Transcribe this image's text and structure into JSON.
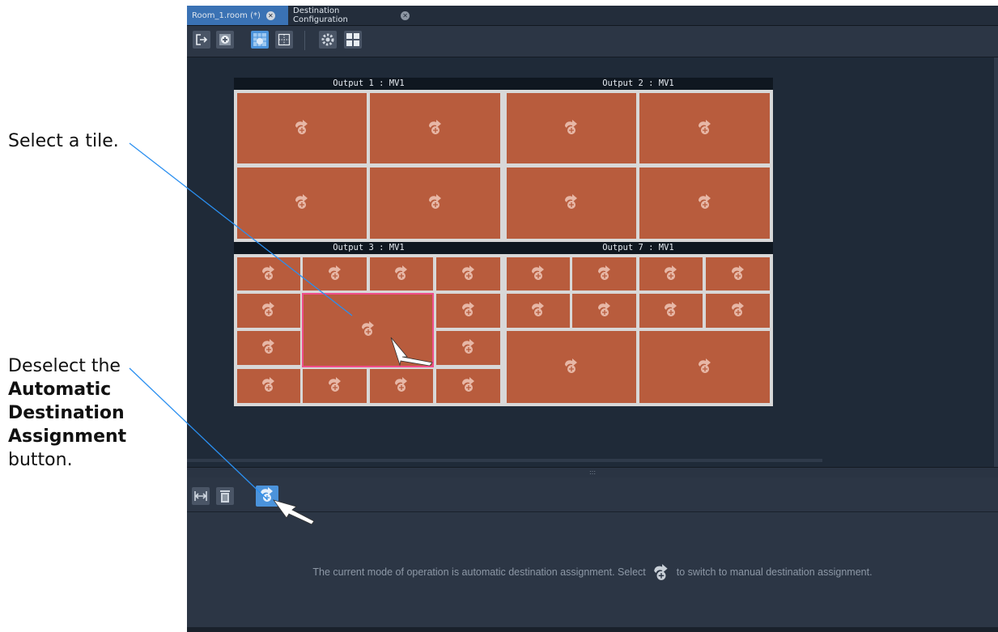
{
  "annotations": {
    "select_tile": "Select a tile.",
    "deselect_line1": "Deselect the",
    "deselect_bold1": "Automatic",
    "deselect_bold2": "Destination",
    "deselect_bold3": "Assignment",
    "deselect_line2": "button."
  },
  "tabs": [
    {
      "label": "Room_1.room (*)",
      "active": true
    },
    {
      "label": "Destination Configuration",
      "active": false
    }
  ],
  "outputs": [
    {
      "title": "Output 1 : MV1",
      "layout": "2x2"
    },
    {
      "title": "Output 2 : MV1",
      "layout": "2x2"
    },
    {
      "title": "Output 3 : MV1",
      "layout": "4x4-center-large",
      "selected_tile": "center-large"
    },
    {
      "title": "Output 7 : MV1",
      "layout": "8-small-2-large"
    }
  ],
  "toolbar_icons": [
    "exit-icon",
    "add-tile-icon",
    "auto-assign-grid-icon",
    "grid-dots-icon",
    "destination-config-icon",
    "layout-quad-icon"
  ],
  "bottom_toolbar_icons": [
    "fit-width-icon",
    "trash-icon",
    "automatic-destination-assignment-icon"
  ],
  "status_message": {
    "before": "The current mode of operation is automatic destination assignment. Select",
    "after": "to switch to manual destination assignment."
  },
  "colors": {
    "tile": "#b85c3d",
    "selected_outline": "#f04e8a",
    "accent": "#4b93db",
    "callout_line": "#2a8ff0"
  }
}
